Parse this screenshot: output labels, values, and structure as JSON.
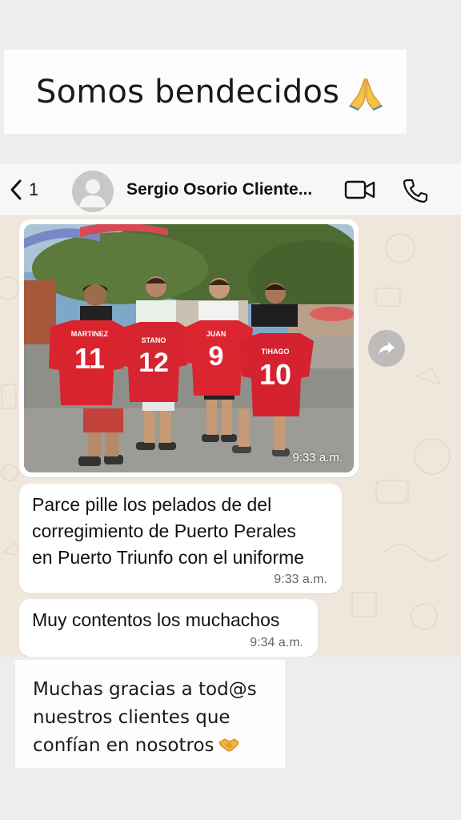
{
  "caption": {
    "text": "Somos bendecidos",
    "emoji": "folded-hands-emoji"
  },
  "header": {
    "back_count": "1",
    "contact_name": "Sergio Osorio Cliente...",
    "icons": [
      "back-arrow-icon",
      "avatar-placeholder",
      "video-call-icon",
      "phone-icon"
    ]
  },
  "photo_message": {
    "time": "9:33 a.m.",
    "shirts": [
      {
        "name": "MARTINEZ",
        "number": "11"
      },
      {
        "name": "STANO",
        "number": "12"
      },
      {
        "name": "JUAN",
        "number": "9"
      },
      {
        "name": "TIHAGO",
        "number": "10"
      }
    ]
  },
  "messages": [
    {
      "lines": [
        "Parce pille los pelados de del",
        "corregimiento de Puerto Perales",
        "en Puerto Triunfo con el uniforme"
      ],
      "time": "9:33 a.m."
    },
    {
      "lines": [
        "Muy contentos los muchachos"
      ],
      "time": "9:34 a.m."
    }
  ],
  "note": {
    "lines": [
      "Muchas gracias a tod@s",
      "nuestros clientes que",
      "confían en nosotros"
    ],
    "emoji": "handshake-emoji"
  },
  "colors": {
    "chat_bg": "#efe7dc",
    "shirt_red": "#d9232d",
    "bubble": "#ffffff"
  }
}
